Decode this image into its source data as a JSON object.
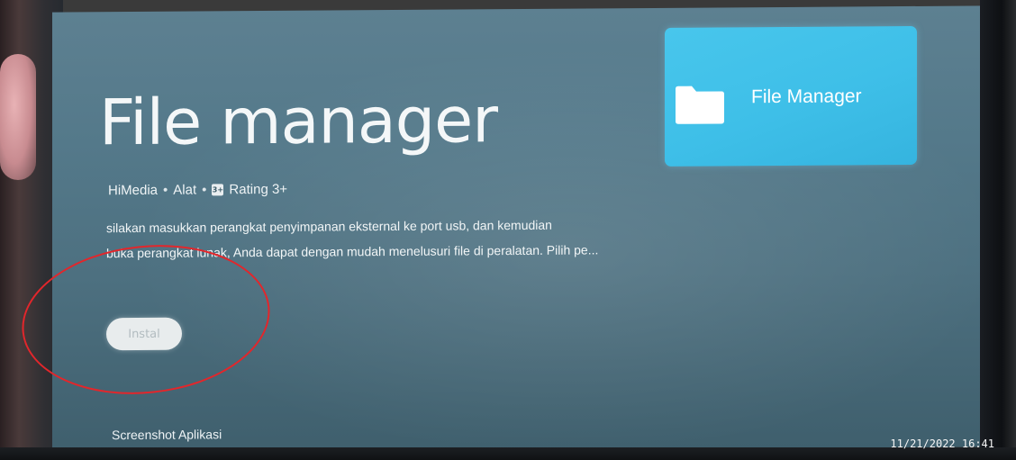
{
  "app": {
    "title": "File manager",
    "developer": "HiMedia",
    "category": "Alat",
    "rating_badge": "3+",
    "rating_label": "Rating 3+",
    "separator": "•",
    "description_lines": [
      "silakan masukkan perangkat penyimpanan eksternal ke port usb, dan kemudian",
      "buka perangkat lunak, Anda dapat dengan mudah menelusuri file di peralatan. Pilih pe..."
    ]
  },
  "actions": {
    "install_label": "Instal"
  },
  "sections": {
    "screenshots_label": "Screenshot Aplikasi"
  },
  "app_card": {
    "label": "File Manager",
    "icon": "folder-icon",
    "color": "#42C2EA"
  },
  "camera": {
    "timestamp": "11/21/2022 16:41"
  },
  "colors": {
    "screen_background": "#54798A",
    "annotation_circle": "#E3262B"
  }
}
